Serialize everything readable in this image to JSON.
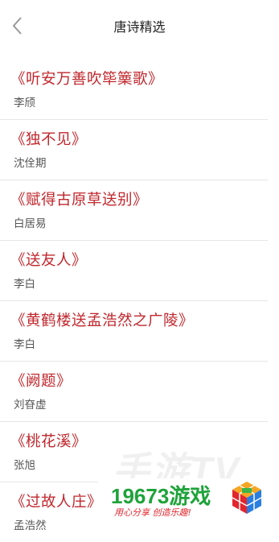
{
  "header": {
    "title": "唐诗精选"
  },
  "poems": [
    {
      "title": "《听安万善吹筚篥歌》",
      "author": "李颀"
    },
    {
      "title": "《独不见》",
      "author": "沈佺期"
    },
    {
      "title": "《赋得古原草送别》",
      "author": "白居易"
    },
    {
      "title": "《送友人》",
      "author": "李白"
    },
    {
      "title": "《黄鹤楼送孟浩然之广陵》",
      "author": "李白"
    },
    {
      "title": "《阙题》",
      "author": "刘昚虚"
    },
    {
      "title": "《桃花溪》",
      "author": "张旭"
    },
    {
      "title": "《过故人庄》",
      "author": "孟浩然"
    }
  ],
  "watermark": {
    "brand_name": "19673游戏",
    "slogan": "用心分享 创造乐趣!",
    "faint_text": "手游TV"
  },
  "colors": {
    "title_red": "#c1272d",
    "brand_green": "#1ea33a"
  }
}
